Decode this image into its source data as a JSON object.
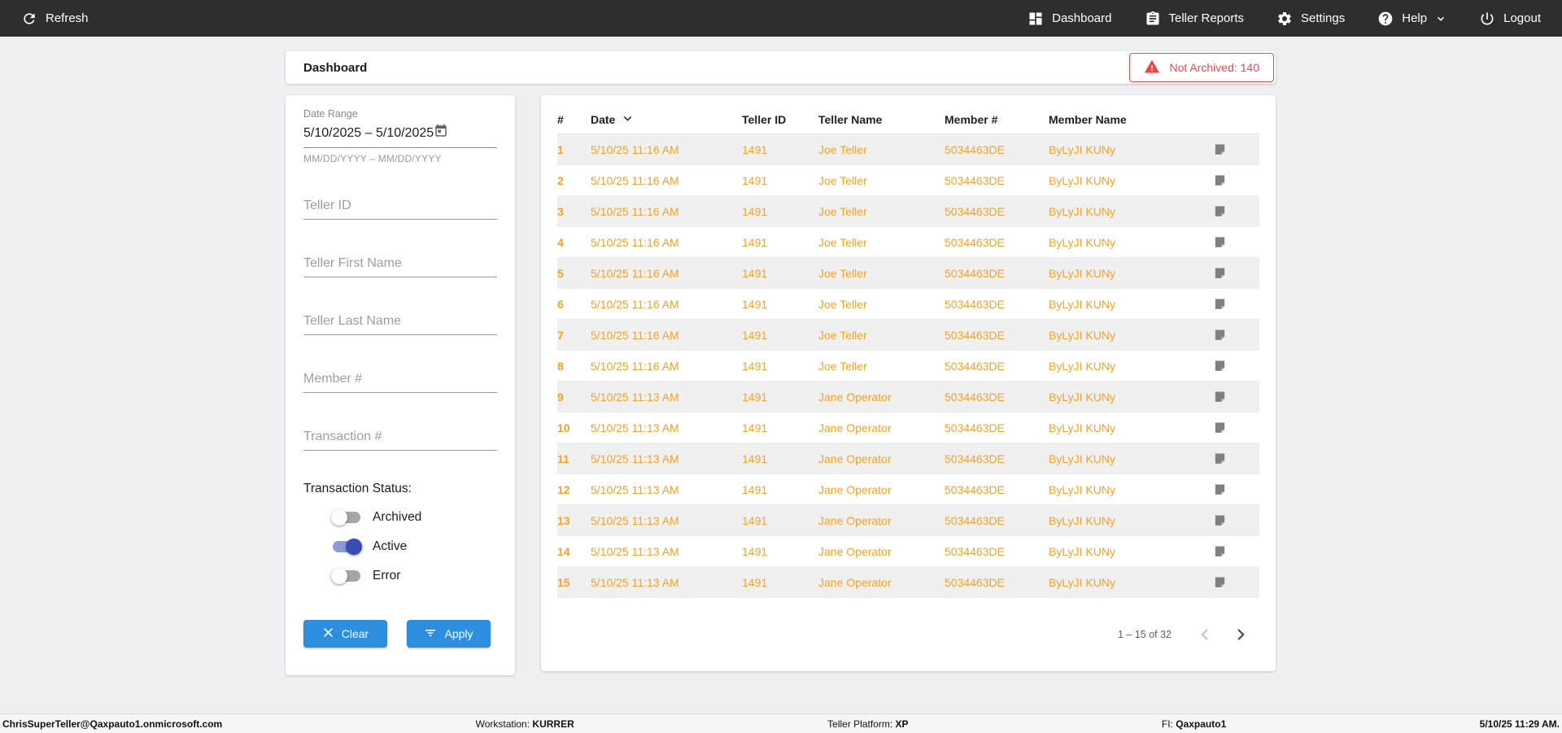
{
  "colors": {
    "nav_bg": "#2e2e2e",
    "accent_blue": "#2d8dde",
    "accent_orange": "#f5a22b",
    "alert_red": "#ef454c",
    "toggle_on_thumb": "#3b4cb8",
    "row_alt_bg": "#f0f0f0"
  },
  "topnav": {
    "refresh_label": "Refresh",
    "items": [
      {
        "label": "Dashboard",
        "icon": "dashboard-icon"
      },
      {
        "label": "Teller Reports",
        "icon": "clipboard-icon"
      },
      {
        "label": "Settings",
        "icon": "gear-icon"
      },
      {
        "label": "Help",
        "icon": "help-icon"
      },
      {
        "label": "Logout",
        "icon": "power-icon"
      }
    ]
  },
  "header": {
    "title": "Dashboard",
    "alert_label": "Not Archived: 140",
    "alert_icon": "warning-icon"
  },
  "filters": {
    "date_range": {
      "label": "Date Range",
      "value": "5/10/2025 – 5/10/2025",
      "helper": "MM/DD/YYYY – MM/DD/YYYY",
      "icon": "calendar-icon"
    },
    "inputs": [
      {
        "placeholder": "Teller ID"
      },
      {
        "placeholder": "Teller First Name"
      },
      {
        "placeholder": "Teller Last Name"
      },
      {
        "placeholder": "Member #"
      },
      {
        "placeholder": "Transaction #"
      }
    ],
    "status": {
      "label": "Transaction Status:",
      "toggles": [
        {
          "label": "Archived",
          "on": false
        },
        {
          "label": "Active",
          "on": true
        },
        {
          "label": "Error",
          "on": false
        }
      ]
    },
    "clear_label": "Clear",
    "apply_label": "Apply"
  },
  "table": {
    "columns": [
      "#",
      "Date",
      "Teller ID",
      "Teller Name",
      "Member #",
      "Member Name"
    ],
    "sort_column": "Date",
    "rows": [
      {
        "num": "1",
        "date": "5/10/25 11:16 AM",
        "teller_id": "1491",
        "teller_name": "Joe Teller",
        "member_num": "5034463DE",
        "member_name": "ByLyJI KUNy"
      },
      {
        "num": "2",
        "date": "5/10/25 11:16 AM",
        "teller_id": "1491",
        "teller_name": "Joe Teller",
        "member_num": "5034463DE",
        "member_name": "ByLyJI KUNy"
      },
      {
        "num": "3",
        "date": "5/10/25 11:16 AM",
        "teller_id": "1491",
        "teller_name": "Joe Teller",
        "member_num": "5034463DE",
        "member_name": "ByLyJI KUNy"
      },
      {
        "num": "4",
        "date": "5/10/25 11:16 AM",
        "teller_id": "1491",
        "teller_name": "Joe Teller",
        "member_num": "5034463DE",
        "member_name": "ByLyJI KUNy"
      },
      {
        "num": "5",
        "date": "5/10/25 11:16 AM",
        "teller_id": "1491",
        "teller_name": "Joe Teller",
        "member_num": "5034463DE",
        "member_name": "ByLyJI KUNy"
      },
      {
        "num": "6",
        "date": "5/10/25 11:16 AM",
        "teller_id": "1491",
        "teller_name": "Joe Teller",
        "member_num": "5034463DE",
        "member_name": "ByLyJI KUNy"
      },
      {
        "num": "7",
        "date": "5/10/25 11:16 AM",
        "teller_id": "1491",
        "teller_name": "Joe Teller",
        "member_num": "5034463DE",
        "member_name": "ByLyJI KUNy"
      },
      {
        "num": "8",
        "date": "5/10/25 11:16 AM",
        "teller_id": "1491",
        "teller_name": "Joe Teller",
        "member_num": "5034463DE",
        "member_name": "ByLyJI KUNy"
      },
      {
        "num": "9",
        "date": "5/10/25 11:13 AM",
        "teller_id": "1491",
        "teller_name": "Jane Operator",
        "member_num": "5034463DE",
        "member_name": "ByLyJI KUNy"
      },
      {
        "num": "10",
        "date": "5/10/25 11:13 AM",
        "teller_id": "1491",
        "teller_name": "Jane Operator",
        "member_num": "5034463DE",
        "member_name": "ByLyJI KUNy"
      },
      {
        "num": "11",
        "date": "5/10/25 11:13 AM",
        "teller_id": "1491",
        "teller_name": "Jane Operator",
        "member_num": "5034463DE",
        "member_name": "ByLyJI KUNy"
      },
      {
        "num": "12",
        "date": "5/10/25 11:13 AM",
        "teller_id": "1491",
        "teller_name": "Jane Operator",
        "member_num": "5034463DE",
        "member_name": "ByLyJI KUNy"
      },
      {
        "num": "13",
        "date": "5/10/25 11:13 AM",
        "teller_id": "1491",
        "teller_name": "Jane Operator",
        "member_num": "5034463DE",
        "member_name": "ByLyJI KUNy"
      },
      {
        "num": "14",
        "date": "5/10/25 11:13 AM",
        "teller_id": "1491",
        "teller_name": "Jane Operator",
        "member_num": "5034463DE",
        "member_name": "ByLyJI KUNy"
      },
      {
        "num": "15",
        "date": "5/10/25 11:13 AM",
        "teller_id": "1491",
        "teller_name": "Jane Operator",
        "member_num": "5034463DE",
        "member_name": "ByLyJI KUNy"
      }
    ],
    "row_note_icon": "note-icon",
    "pagination": {
      "range_label": "1 – 15 of 32",
      "prev_enabled": false,
      "next_enabled": true
    }
  },
  "footer": {
    "user": "ChrisSuperTeller@Qaxpauto1.onmicrosoft.com",
    "workstation_label": "Workstation: ",
    "workstation_value": "KURRER",
    "platform_label": "Teller Platform: ",
    "platform_value": "XP",
    "fi_label": "FI: ",
    "fi_value": "Qaxpauto1",
    "datetime": "5/10/25 11:29 AM."
  }
}
